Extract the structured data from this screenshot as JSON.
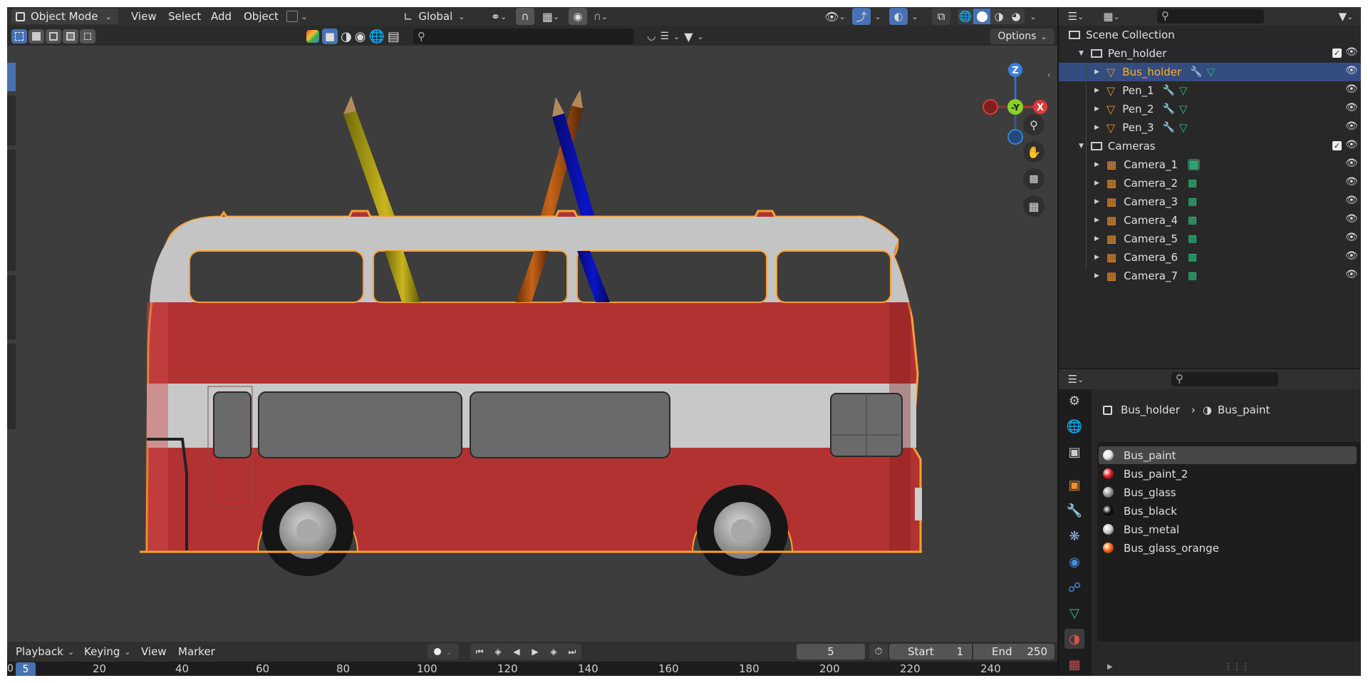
{
  "header": {
    "mode": "Object Mode",
    "menus": [
      "View",
      "Select",
      "Add",
      "Object"
    ],
    "transform_orientation": "Global",
    "options_label": "Options"
  },
  "viewport": {
    "gizmo": {
      "z": "Z",
      "y": "-Y",
      "x": "X"
    }
  },
  "outliner": {
    "root": "Scene Collection",
    "rows": [
      {
        "label": "Pen_holder",
        "type": "collection"
      },
      {
        "label": "Bus_holder",
        "type": "mesh",
        "selected": true
      },
      {
        "label": "Pen_1",
        "type": "mesh"
      },
      {
        "label": "Pen_2",
        "type": "mesh"
      },
      {
        "label": "Pen_3",
        "type": "mesh"
      },
      {
        "label": "Cameras",
        "type": "collection"
      },
      {
        "label": "Camera_1",
        "type": "camera"
      },
      {
        "label": "Camera_2",
        "type": "camera"
      },
      {
        "label": "Camera_3",
        "type": "camera"
      },
      {
        "label": "Camera_4",
        "type": "camera"
      },
      {
        "label": "Camera_5",
        "type": "camera"
      },
      {
        "label": "Camera_6",
        "type": "camera"
      },
      {
        "label": "Camera_7",
        "type": "camera"
      }
    ]
  },
  "properties": {
    "breadcrumb_object": "Bus_holder",
    "breadcrumb_material": "Bus_paint",
    "materials": [
      {
        "name": "Bus_paint",
        "color": "#e8e8e8"
      },
      {
        "name": "Bus_paint_2",
        "color": "#e02020"
      },
      {
        "name": "Bus_glass",
        "color": "#9a9a9a"
      },
      {
        "name": "Bus_black",
        "color": "#111111"
      },
      {
        "name": "Bus_metal",
        "color": "#d0d0d0"
      },
      {
        "name": "Bus_glass_orange",
        "color": "#ff6a10"
      }
    ]
  },
  "timeline": {
    "menus": [
      "Playback",
      "Keying",
      "View",
      "Marker"
    ],
    "current_frame": "5",
    "start_label": "Start",
    "start_value": "1",
    "end_label": "End",
    "end_value": "250",
    "ruler_current": "5",
    "ruler_ticks": [
      "20",
      "40",
      "60",
      "80",
      "100",
      "120",
      "140",
      "160",
      "180",
      "200",
      "220",
      "240"
    ]
  },
  "colors": {
    "selection_blue": "#4772b3",
    "outline_orange": "#ffa033",
    "bus_red": "#b03434"
  }
}
